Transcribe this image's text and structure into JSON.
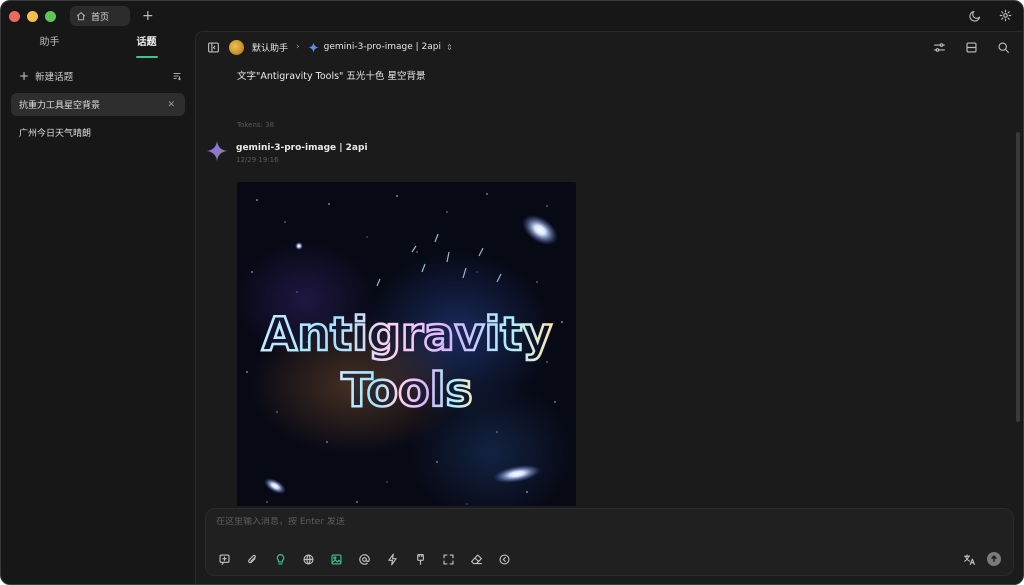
{
  "window": {
    "traffic_colors": [
      "#ed6a5e",
      "#f4bf4f",
      "#61c554"
    ],
    "tab_label": "首页",
    "new_tab_label": "+"
  },
  "sidebar": {
    "tabs": [
      {
        "label": "助手"
      },
      {
        "label": "话题"
      }
    ],
    "active_tab": 1,
    "new_topic_label": "新建话题",
    "topics": [
      {
        "label": "抗重力工具星空背景",
        "active": true
      },
      {
        "label": "广州今日天气晴朗",
        "active": false
      }
    ]
  },
  "header": {
    "assistant_name": "默认助手",
    "model_name": "gemini-3-pro-image | 2api"
  },
  "messages": {
    "user_text": "文字\"Antigravity Tools\" 五光十色 星空背景",
    "user_meta": "Tokens: 38",
    "bot_name": "gemini-3-pro-image | 2api",
    "bot_time": "12/29 19:16",
    "image_text_line1": "Antigravity",
    "image_text_line2": "Tools"
  },
  "composer": {
    "placeholder": "在这里输入消息，按 Enter 发送"
  },
  "colors": {
    "accent": "#3cc48a",
    "window_bg": "#171717",
    "main_bg": "#1b1b1b"
  },
  "icons": {
    "toolbar": [
      "new-chat-icon",
      "paperclip-icon",
      "lightbulb-icon",
      "globe-icon",
      "image-icon",
      "at-icon",
      "lightning-icon",
      "usb-icon",
      "expand-icon",
      "eraser-icon",
      "translate-arrow-icon"
    ]
  }
}
